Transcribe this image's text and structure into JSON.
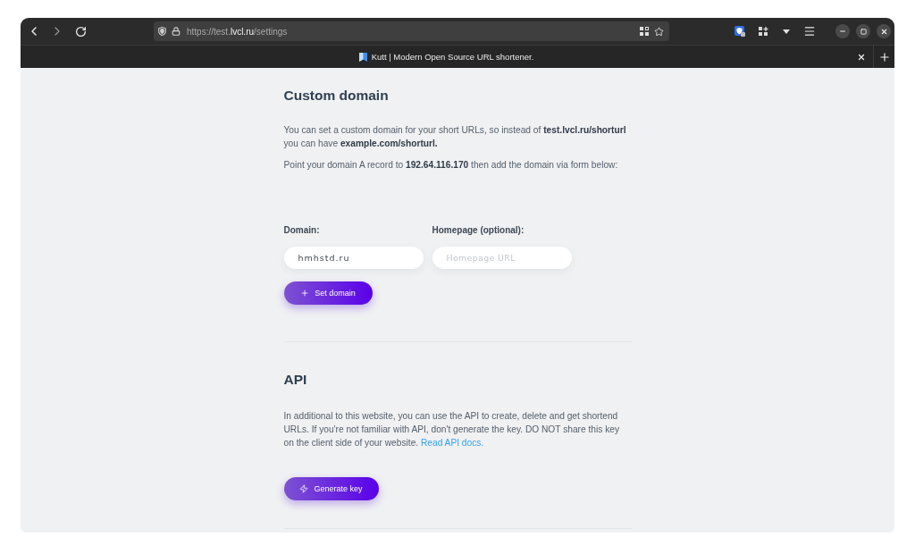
{
  "browser": {
    "address_bar": {
      "prefix": "https://test.",
      "domain": "lvcl.ru",
      "path": "/settings"
    },
    "tab": {
      "title": "Kutt | Modern Open Source URL shortener."
    }
  },
  "custom_domain": {
    "title": "Custom domain",
    "paragraphs": [
      "You can set a custom domain for your short URLs, so instead of **test.lvcl.ru/shorturl** you can have **example.com/shorturl.**",
      "Point your domain A record to **192.64.116.170** then add the domain via form below:"
    ],
    "fields": [
      {
        "label": "Domain:",
        "value": "hmhstd.ru"
      },
      {
        "label": "Homepage (optional):",
        "placeholder": "Homepage URL"
      }
    ],
    "button": {
      "label": "Set domain"
    }
  },
  "api": {
    "title": "API",
    "description": "In additional to this website, you can use the API to create, delete and get shortend URLs. If you're not familiar with API, don't generate the key. DO NOT share this key on the client side of your website.",
    "link": "Read API docs.",
    "button": {
      "label": "Generate key"
    }
  }
}
